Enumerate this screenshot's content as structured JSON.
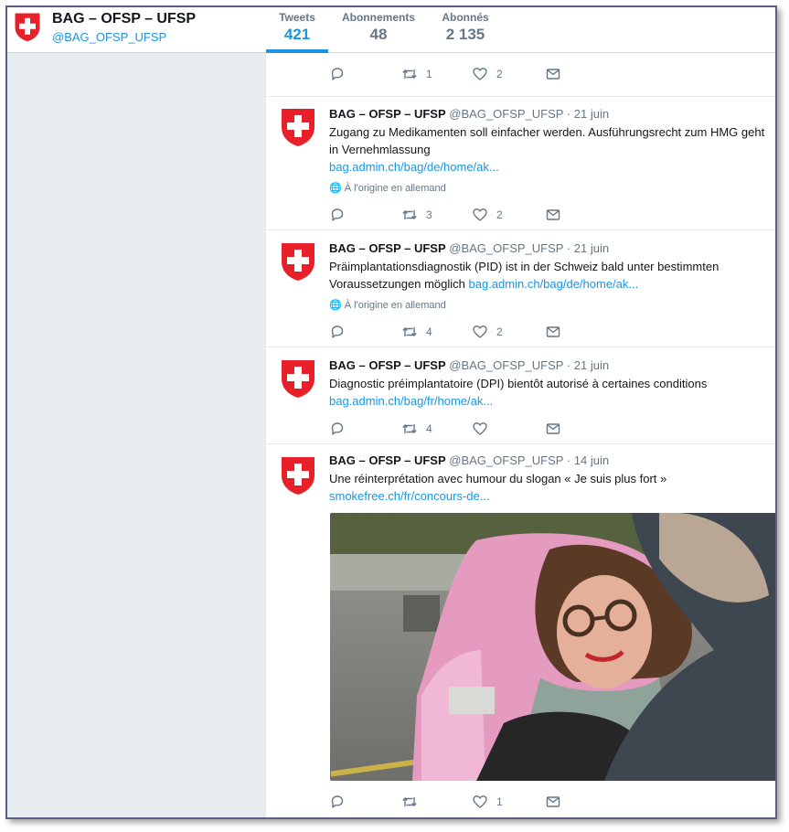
{
  "profile": {
    "name": "BAG – OFSP – UFSP",
    "handle": "@BAG_OFSP_UFSP"
  },
  "stats": [
    {
      "label": "Tweets",
      "value": "421"
    },
    {
      "label": "Abonnements",
      "value": "48"
    },
    {
      "label": "Abonnés",
      "value": "2 135"
    }
  ],
  "top_actions": {
    "retweets": "1",
    "likes": "2"
  },
  "tweets": [
    {
      "name": "BAG – OFSP – UFSP",
      "meta": "@BAG_OFSP_UFSP · 21 juin",
      "text": "Zugang zu Medikamenten soll einfacher werden. Ausführungsrecht zum HMG geht in Vernehmlassung",
      "link": "bag.admin.ch/bag/de/home/ak...",
      "lang": "À l'origine en allemand",
      "retweets": "3",
      "likes": "2"
    },
    {
      "name": "BAG – OFSP – UFSP",
      "meta": "@BAG_OFSP_UFSP · 21 juin",
      "text": "Präimplantationsdiagnostik (PID) ist in der Schweiz bald unter bestimmten Voraussetzungen möglich",
      "link": "bag.admin.ch/bag/de/home/ak...",
      "lang": "À l'origine en allemand",
      "retweets": "4",
      "likes": "2"
    },
    {
      "name": "BAG – OFSP – UFSP",
      "meta": "@BAG_OFSP_UFSP · 21 juin",
      "text": "Diagnostic préimplantatoire (DPI) bientôt autorisé à certaines conditions",
      "link": "bag.admin.ch/bag/fr/home/ak...",
      "retweets": "4",
      "likes": ""
    },
    {
      "name": "BAG – OFSP – UFSP",
      "meta": "@BAG_OFSP_UFSP · 14 juin",
      "text": "Une réinterprétation avec humour du slogan « Je suis plus fort »",
      "link": "smokefree.ch/fr/concours-de...",
      "retweets": "",
      "likes": "1"
    }
  ],
  "colors": {
    "brand_red": "#e8202a",
    "link_blue": "#1b95e0",
    "background": "#e6ecf0"
  },
  "icons": [
    "swiss-shield-logo",
    "reply-icon",
    "retweet-icon",
    "like-icon",
    "message-icon",
    "globe-icon",
    "chevron-down-icon"
  ]
}
